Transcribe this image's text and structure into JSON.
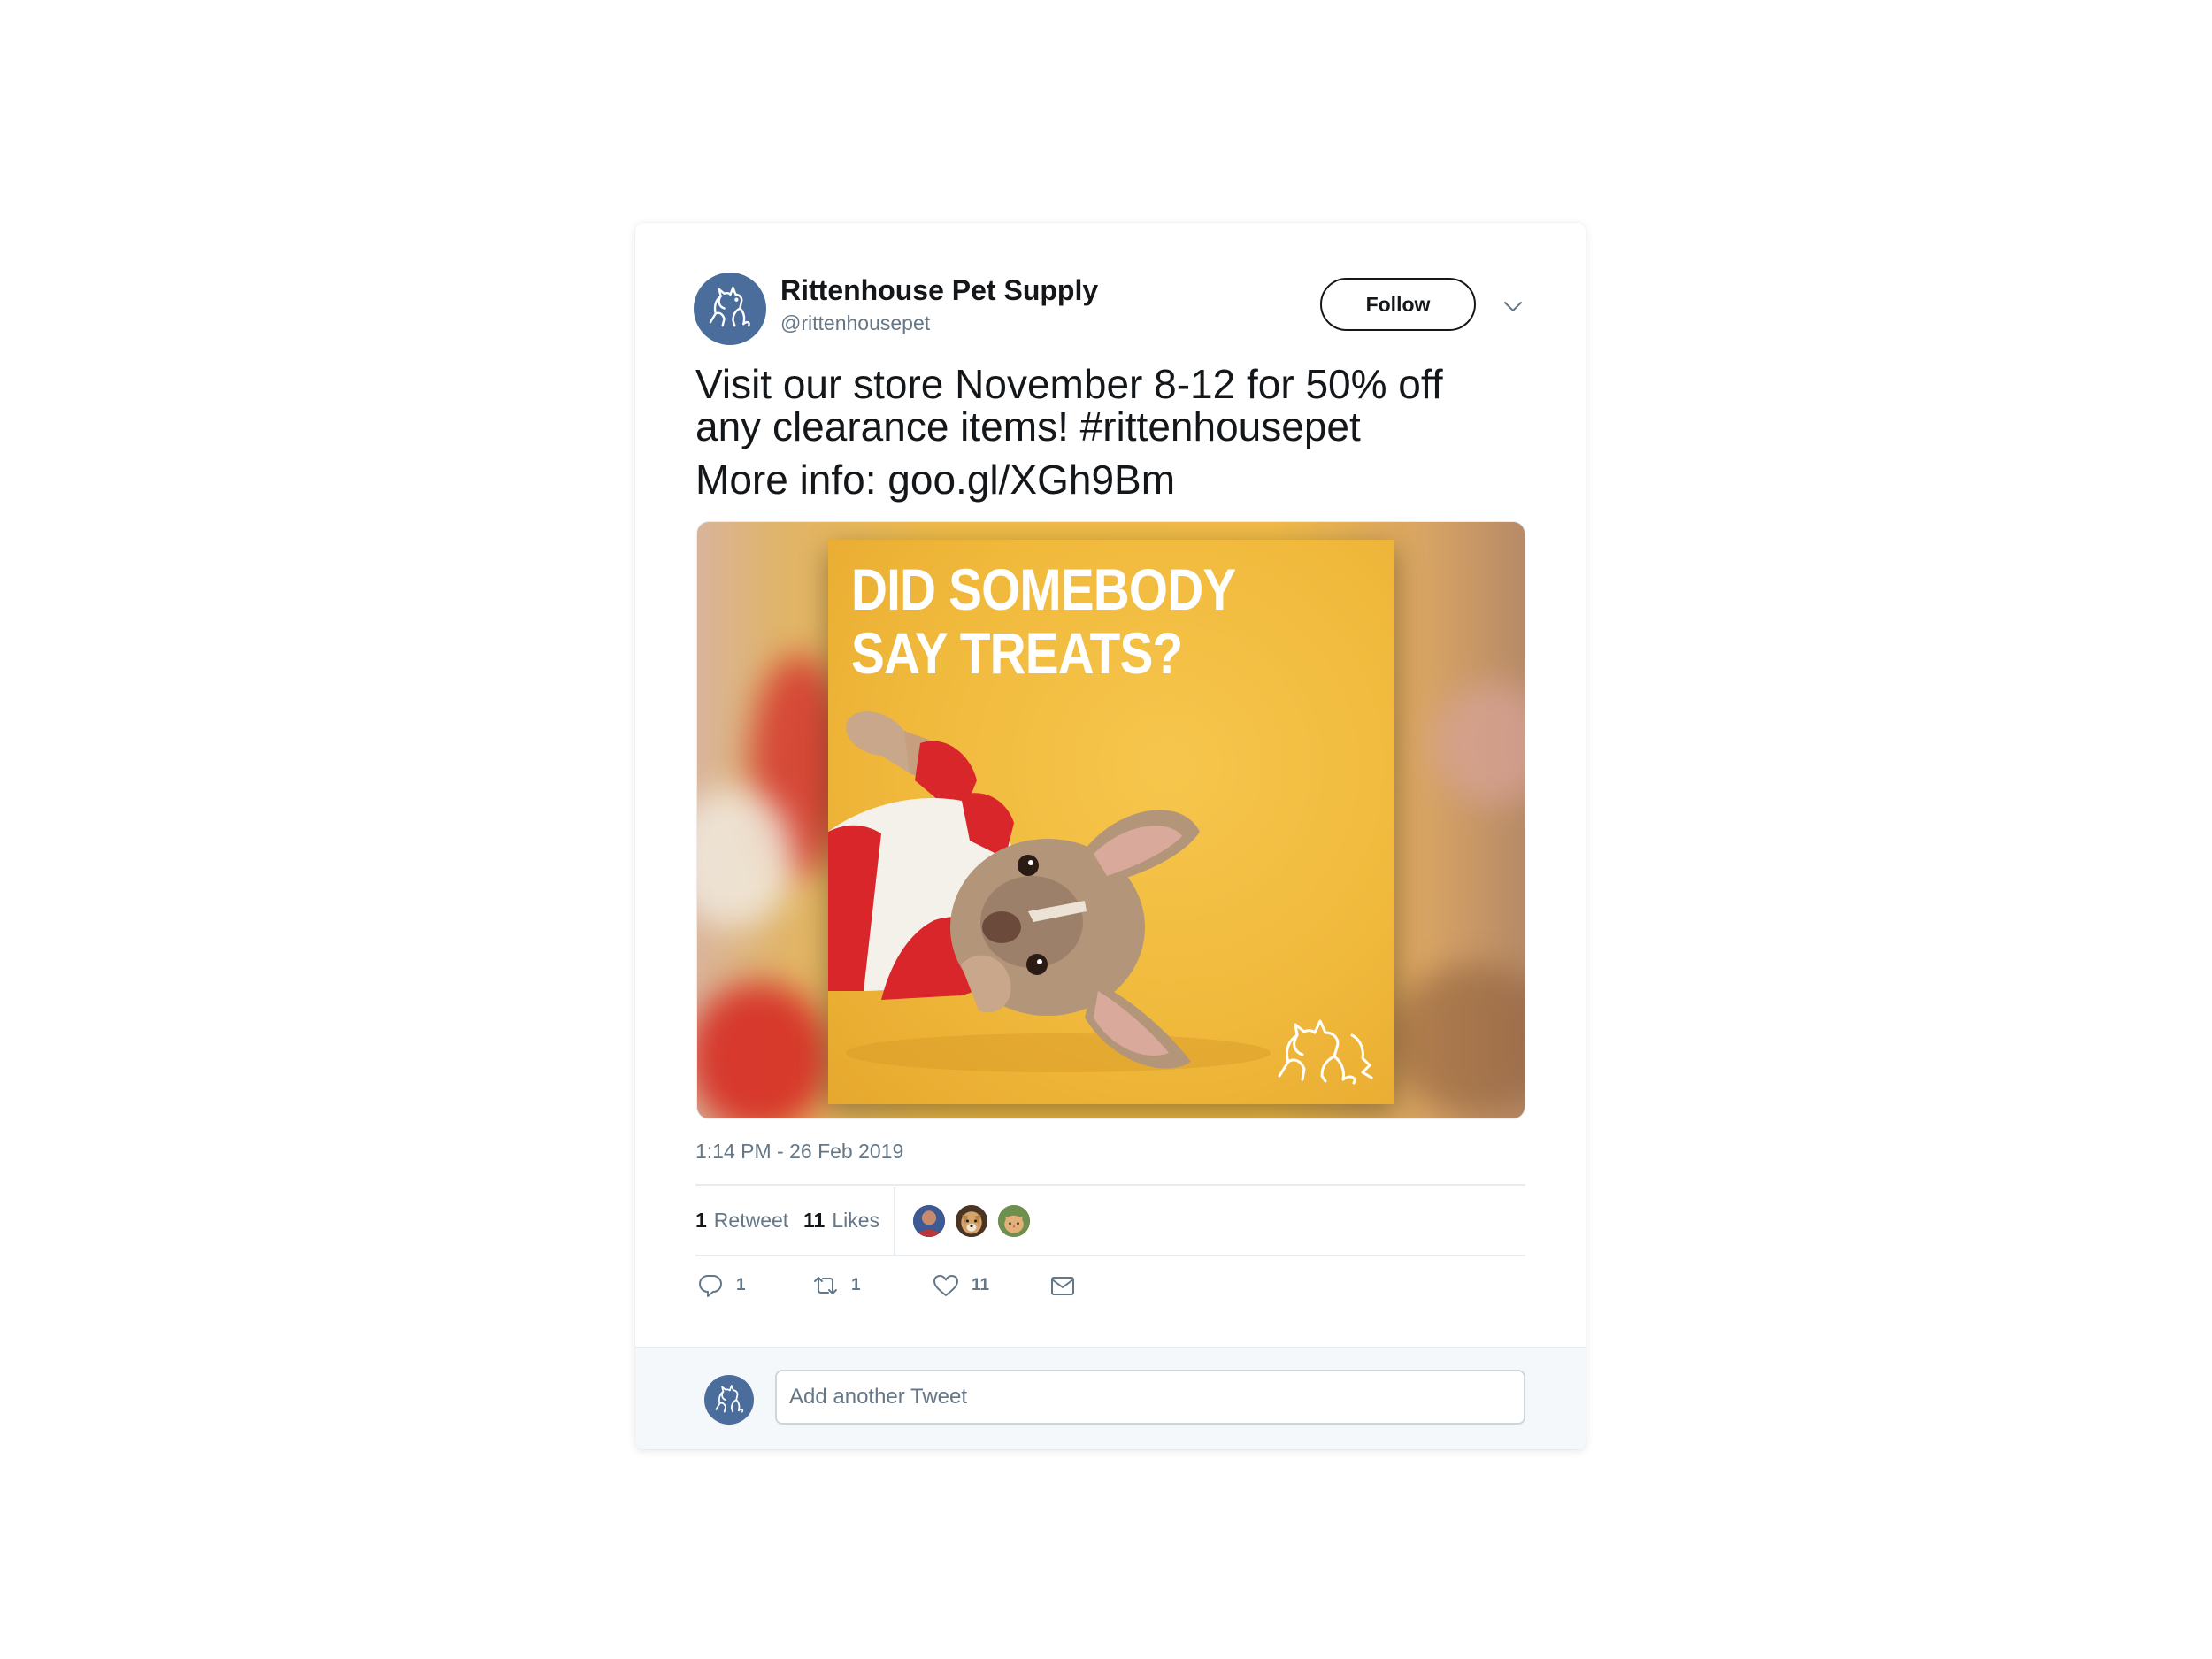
{
  "tweet": {
    "author": {
      "name": "Rittenhouse Pet Supply",
      "handle": "@rittenhousepet",
      "avatar_icon": "dog-cat-logo-icon",
      "avatar_color": "#4a6d9c"
    },
    "follow_label": "Follow",
    "menu_icon": "chevron-down-icon",
    "text_lines": [
      "Visit our store November 8-12 for 50% off",
      "any clearance items! #rittenhousepet"
    ],
    "more_info": "More info: goo.gl/XGh9Bm",
    "media": {
      "headline_lines": [
        "DID SOMEBODY",
        "SAY TREATS?"
      ],
      "background_color": "#f0bb48",
      "subject": "french-bulldog-in-red-sweater",
      "logo_icon": "dog-cat-logo-icon"
    },
    "timestamp": "1:14 PM - 26 Feb 2019",
    "stats": {
      "retweets_count": "1",
      "retweets_label": "Retweet",
      "likes_count": "11",
      "likes_label": "Likes"
    },
    "likers": [
      "avatar-person",
      "avatar-dog",
      "avatar-cat"
    ],
    "actions": {
      "reply_icon": "reply-icon",
      "reply_count": "1",
      "retweet_icon": "retweet-icon",
      "retweet_count": "1",
      "like_icon": "heart-icon",
      "like_count": "11",
      "message_icon": "envelope-icon"
    },
    "reply": {
      "placeholder": "Add another Tweet"
    }
  }
}
